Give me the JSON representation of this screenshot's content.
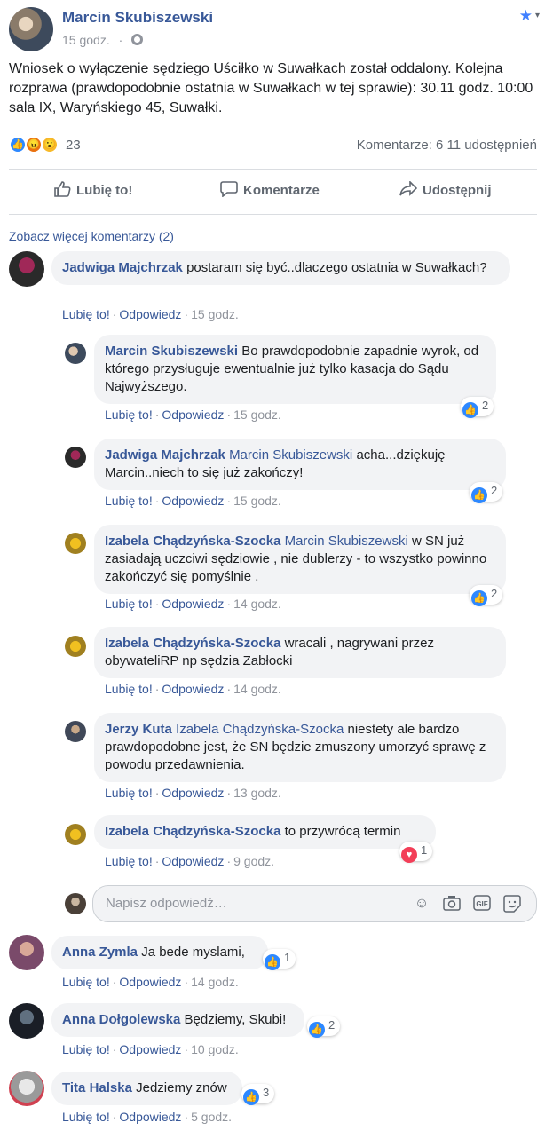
{
  "post": {
    "author": "Marcin Skubiszewski",
    "time": "15 godz.",
    "separator": "·",
    "text": "Wniosek o wyłączenie sędziego Uściłko w Suwałkach został oddalony. Kolejna rozprawa (prawdopodobnie ostatnia w Suwałkach w tej sprawie): 30.11 godz. 10:00 sala IX, Waryńskiego 45, Suwałki.",
    "reaction_count": "23",
    "stats": "Komentarze: 6  11 udostępnień",
    "icons": {
      "star": "star-icon",
      "globe": "globe-icon"
    }
  },
  "actions": {
    "like": "Lubię to!",
    "comment": "Komentarze",
    "share": "Udostępnij"
  },
  "more_comments": "Zobacz więcej komentarzy (2)",
  "comment_actions": {
    "like": "Lubię to!",
    "reply": "Odpowiedz",
    "dot": "·"
  },
  "comments": [
    {
      "author": "Jadwiga Majchrzak",
      "mention": "",
      "text": "postaram się być..dlaczego ostatnia w Suwałkach?",
      "time": "15 godz.",
      "reactions": ""
    },
    {
      "author": "Marcin Skubiszewski",
      "mention": "",
      "text": "Bo prawdopodobnie zapadnie wyrok, od którego przysługuje ewentualnie już tylko kasacja do Sądu Najwyższego.",
      "time": "15 godz.",
      "reactions": "2"
    },
    {
      "author": "Jadwiga Majchrzak",
      "mention": "Marcin Skubiszewski",
      "text": "acha...dziękuję Marcin..niech to się już zakończy!",
      "time": "15 godz.",
      "reactions": "2"
    },
    {
      "author": "Izabela Chądzyńska-Szocka",
      "mention": "Marcin Skubiszewski",
      "text": "w SN już zasiadają uczciwi sędziowie , nie dublerzy - to wszystko powinno zakończyć się pomyślnie .",
      "time": "14 godz.",
      "reactions": "2"
    },
    {
      "author": "Izabela Chądzyńska-Szocka",
      "mention": "",
      "text": "wracali , nagrywani przez obywateliRP np sędzia Zabłocki",
      "time": "14 godz.",
      "reactions": ""
    },
    {
      "author": "Jerzy Kuta",
      "mention": "Izabela Chądzyńska-Szocka",
      "text": "niestety ale bardzo prawdopodobne jest, że SN będzie zmuszony umorzyć sprawę z powodu przedawnienia.",
      "time": "13 godz.",
      "reactions": ""
    },
    {
      "author": "Izabela Chądzyńska-Szocka",
      "mention": "",
      "text": "to przywrócą termin",
      "time": "9 godz.",
      "reactions": "1"
    },
    {
      "author": "Anna Zymla",
      "mention": "",
      "text": "Ja bede myslami,",
      "time": "14 godz.",
      "reactions": "1"
    },
    {
      "author": "Anna Dołgolewska",
      "mention": "",
      "text": "Będziemy, Skubi!",
      "time": "10 godz.",
      "reactions": "2"
    },
    {
      "author": "Tita Halska",
      "mention": "",
      "text": "Jedziemy znów",
      "time": "5 godz.",
      "reactions": "3"
    }
  ],
  "reply_box": {
    "placeholder": "Napisz odpowiedź…",
    "icons": [
      "emoji-icon",
      "camera-icon",
      "gif-icon",
      "sticker-icon"
    ]
  },
  "colors": {
    "link": "#385898",
    "bubble": "#f2f3f5",
    "like_blue": "#2d88ff",
    "heart_red": "#f33e58"
  }
}
